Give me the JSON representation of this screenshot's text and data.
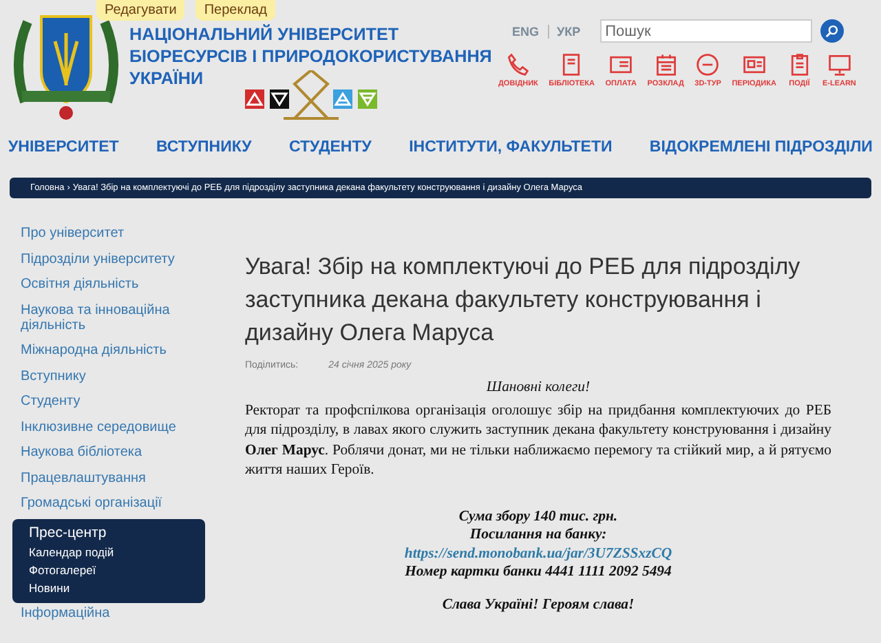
{
  "toolbar_buttons": [
    "Редагувати",
    "Переклад"
  ],
  "site_title": [
    "НАЦІОНАЛЬНИЙ УНІВЕРСИТЕТ",
    "БІОРЕСУРСІВ І ПРИРОДОКОРИСТУВАННЯ",
    "УКРАЇНИ"
  ],
  "languages": [
    "ENG",
    "УКР"
  ],
  "search": {
    "placeholder": "Пошук"
  },
  "quick_links": [
    {
      "kind": "phone",
      "label": "ДОВІДНИК"
    },
    {
      "kind": "book",
      "label": "БІБЛІОТЕКА"
    },
    {
      "kind": "payment",
      "label": "ОПЛАТА"
    },
    {
      "kind": "calendar",
      "label": "РОЗКЛАД"
    },
    {
      "kind": "tour",
      "label": "3D-ТУР"
    },
    {
      "kind": "newspaper",
      "label": "ПЕРІОДИКА"
    },
    {
      "kind": "clipboard",
      "label": "ПОДІЇ"
    },
    {
      "kind": "monitor",
      "label": "E-LEARN"
    }
  ],
  "nav": [
    "УНІВЕРСИТЕТ",
    "ВСТУПНИКУ",
    "СТУДЕНТУ",
    "ІНСТИТУТИ, ФАКУЛЬТЕТИ",
    "ВІДОКРЕМЛЕНІ ПІДРОЗДІЛИ"
  ],
  "breadcrumb": {
    "home": "Головна",
    "separator": "›",
    "current": "Увага! Збір на комплектуючі до РЕБ для підрозділу заступника декана факультету конструювання і дизайну Олега Маруса"
  },
  "sidebar": {
    "items": [
      "Про університет",
      "Підрозділи університету",
      "Освітня діяльність",
      "Наукова та інноваційна діяльність",
      "Міжнародна діяльність",
      "Вступнику",
      "Студенту",
      "Інклюзивне середовище",
      "Наукова бібліотека",
      "Працевлаштування",
      "Громадські організації"
    ],
    "press_center": {
      "title": "Прес-центр",
      "children": [
        "Календар подій",
        "Фотогалереї",
        "Новини"
      ]
    },
    "after": [
      "Інформаційна"
    ]
  },
  "article": {
    "title": "Увага! Збір на комплектуючі до РЕБ для підрозділу заступника декана факультету конструювання і дизайну Олега Маруса",
    "share_label": "Поділитись:",
    "date": "24 січня 2025 року",
    "greeting": "Шановні колеги!",
    "paragraph": "Ректорат та профспілкова організація оголошує збір на придбання комплектуючих до РЕБ  для підрозділу, в лавах якого служить заступник декана факультету конструювання і дизайну **Олег Марус**. Роблячи донат, ми не тільки наближаємо перемогу та стійкий мир, а й рятуємо життя наших Героїв.",
    "amount": "Сума збору 140 тис. грн.",
    "link_label": "Посилання на банку:",
    "link": "https://send.monobank.ua/jar/3U7ZSSxzCQ",
    "card": "Номер картки банки 4441 1111 2092 5494",
    "closing": "Слава Україні! Героям слава!"
  }
}
